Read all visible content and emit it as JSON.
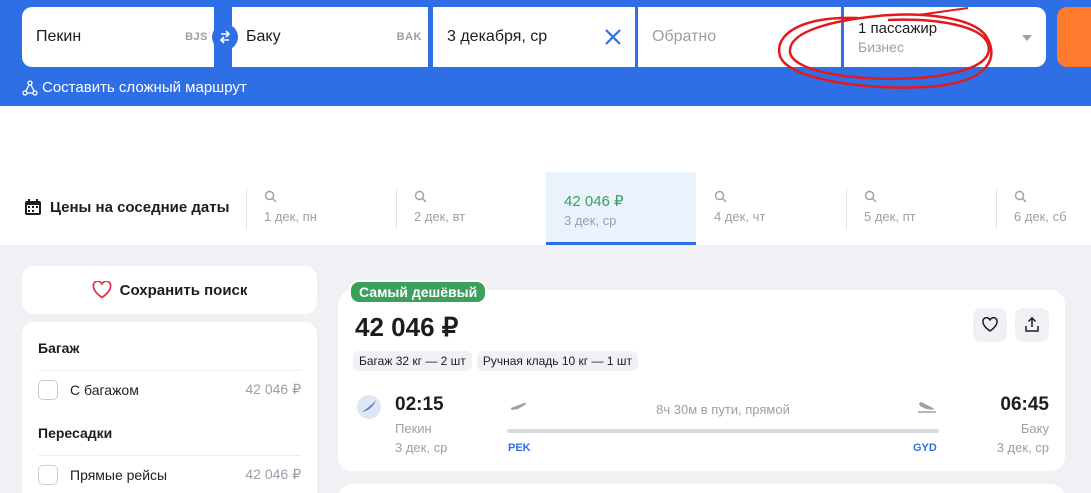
{
  "search": {
    "from_city": "Пекин",
    "from_code": "BJS",
    "to_city": "Баку",
    "to_code": "BAK",
    "depart_date": "3 декабря, ср",
    "return_placeholder": "Обратно",
    "passengers": "1 пассажир",
    "cabin_class": "Бизнес",
    "complex_route": "Составить сложный маршрут"
  },
  "dates_strip": {
    "title": "Цены на соседние даты",
    "days": [
      {
        "label": "1 дек, пн",
        "price": null
      },
      {
        "label": "2 дек, вт",
        "price": null
      },
      {
        "label": "3 дек, ср",
        "price": "42 046 ₽",
        "active": true
      },
      {
        "label": "4 дек, чт",
        "price": null
      },
      {
        "label": "5 дек, пт",
        "price": null
      },
      {
        "label": "6 дек, сб",
        "price": null
      }
    ]
  },
  "sidebar": {
    "save_search": "Сохранить поиск",
    "baggage_title": "Багаж",
    "baggage_option": "С багажом",
    "baggage_price": "42 046 ₽",
    "transfers_title": "Пересадки",
    "transfers_option": "Прямые рейсы",
    "transfers_price": "42 046 ₽"
  },
  "ticket": {
    "badge": "Самый дешёвый",
    "price": "42 046 ₽",
    "baggage_chip": "Багаж 32 кг — 2 шт",
    "carryon_chip": "Ручная кладь 10 кг — 1 шт",
    "depart_time": "02:15",
    "depart_city": "Пекин",
    "depart_date": "3 дек, ср",
    "depart_iata": "PEK",
    "duration": "8ч 30м в пути, прямой",
    "arrive_time": "06:45",
    "arrive_city": "Баку",
    "arrive_date": "3 дек, ср",
    "arrive_iata": "GYD"
  },
  "colors": {
    "brand_blue": "#2f6fe6",
    "cta_orange": "#ff7a2c",
    "price_green": "#3aa05c",
    "annotation_red": "#e3191b"
  },
  "icons": [
    "swap-icon",
    "clear-icon",
    "chevron-down-icon",
    "route-icon",
    "calendar-icon",
    "search-icon",
    "heart-icon",
    "share-icon",
    "airline-logo-icon",
    "takeoff-icon",
    "landing-icon"
  ]
}
